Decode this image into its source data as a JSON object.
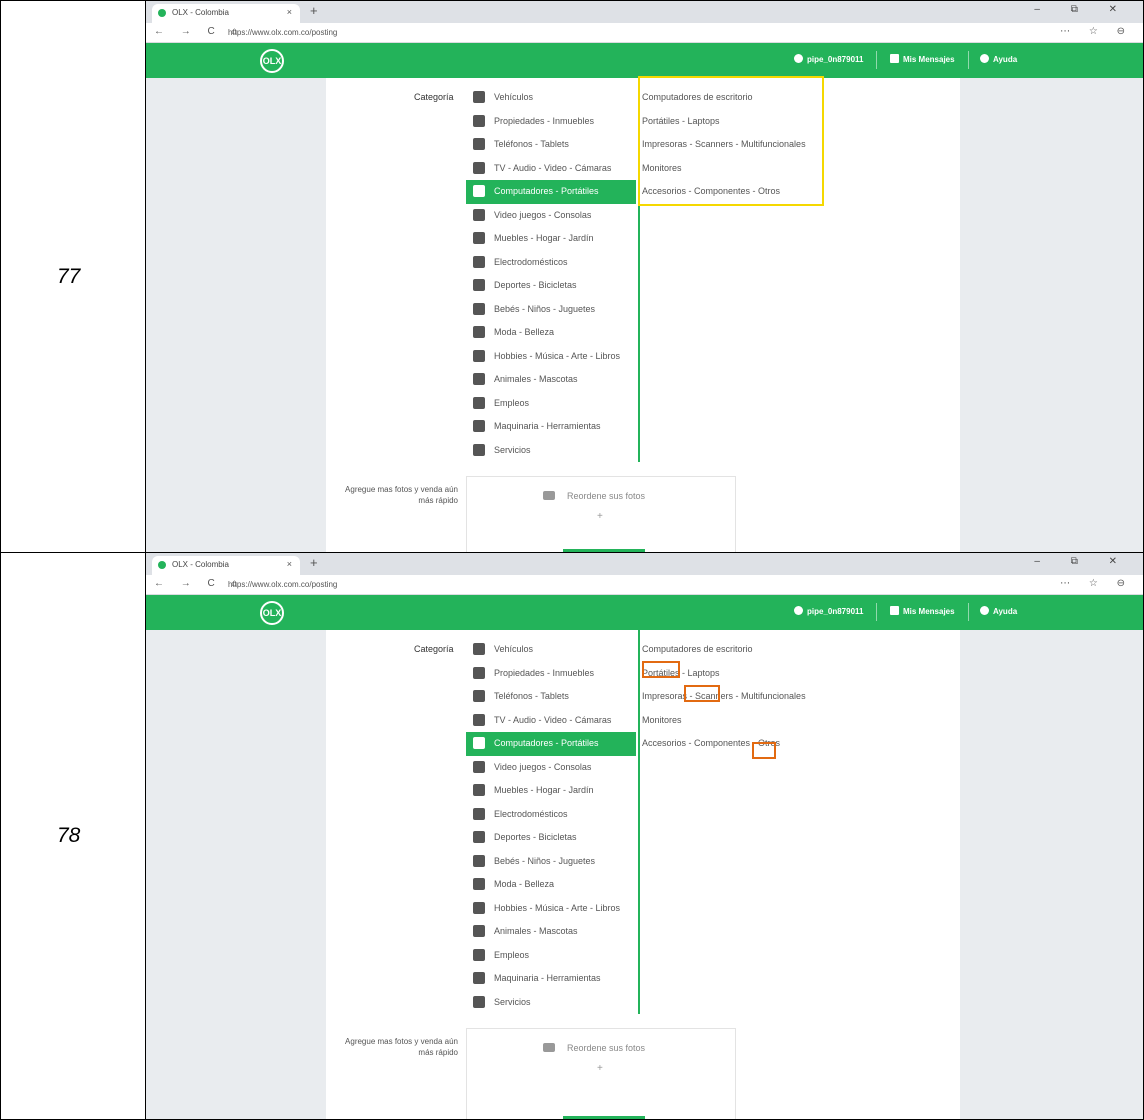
{
  "rows": [
    {
      "number": "77",
      "browser": {
        "tab_title": "OLX - Colombia",
        "tab_close": "×",
        "new_tab": "+",
        "window_controls": "– ⧉ ✕",
        "url": "https://www.olx.com.co/posting",
        "nav_icons": "← → C ⌂",
        "right_icons": "⋯ ☆ ⊖"
      },
      "header": {
        "logo": "OLX",
        "user": "pipe_0n879011",
        "messages": "Mis Mensajes",
        "help": "Ayuda"
      },
      "category_label": "Categoría",
      "categories": [
        "Vehículos",
        "Propiedades - Inmuebles",
        "Teléfonos - Tablets",
        "TV - Audio - Video - Cámaras",
        "Computadores - Portátiles",
        "Video juegos - Consolas",
        "Muebles - Hogar - Jardín",
        "Electrodomésticos",
        "Deportes - Bicicletas",
        "Bebés - Niños - Juguetes",
        "Moda - Belleza",
        "Hobbies - Música - Arte - Libros",
        "Animales - Mascotas",
        "Empleos",
        "Maquinaria - Herramientas",
        "Servicios"
      ],
      "active_category": "Computadores - Portátiles",
      "subcategories": [
        "Computadores de escritorio",
        "Portátiles - Laptops",
        "Impresoras - Scanners - Multifuncionales",
        "Monitores",
        "Accesorios - Componentes - Otros"
      ],
      "photo_prompt": "Agregue mas fotos y venda aún más rápido",
      "photo_button": "Reordene sus fotos",
      "photo_plus": "+"
    },
    {
      "number": "78",
      "browser": {
        "tab_title": "OLX - Colombia",
        "tab_close": "×",
        "new_tab": "+",
        "window_controls": "– ⧉ ✕",
        "url": "https://www.olx.com.co/posting",
        "nav_icons": "← → C ⌂",
        "right_icons": "⋯ ☆ ⊖"
      },
      "header": {
        "logo": "OLX",
        "user": "pipe_0n879011",
        "messages": "Mis Mensajes",
        "help": "Ayuda"
      },
      "category_label": "Categoría",
      "categories": [
        "Vehículos",
        "Propiedades - Inmuebles",
        "Teléfonos - Tablets",
        "TV - Audio - Video - Cámaras",
        "Computadores - Portátiles",
        "Video juegos - Consolas",
        "Muebles - Hogar - Jardín",
        "Electrodomésticos",
        "Deportes - Bicicletas",
        "Bebés - Niños - Juguetes",
        "Moda - Belleza",
        "Hobbies - Música - Arte - Libros",
        "Animales - Mascotas",
        "Empleos",
        "Maquinaria - Herramientas",
        "Servicios"
      ],
      "active_category": "Computadores - Portátiles",
      "subcategories": [
        "Computadores de escritorio",
        "Portátiles - Laptops",
        "Impresoras - Scanners - Multifuncionales",
        "Monitores",
        "Accesorios - Componentes - Otros"
      ],
      "photo_prompt": "Agregue mas fotos y venda aún más rápido",
      "photo_button": "Reordene sus fotos",
      "photo_plus": "+"
    }
  ],
  "colors": {
    "brand_green": "#23b35a",
    "highlight_yellow": "#f5d800",
    "highlight_orange": "#e26a11"
  }
}
